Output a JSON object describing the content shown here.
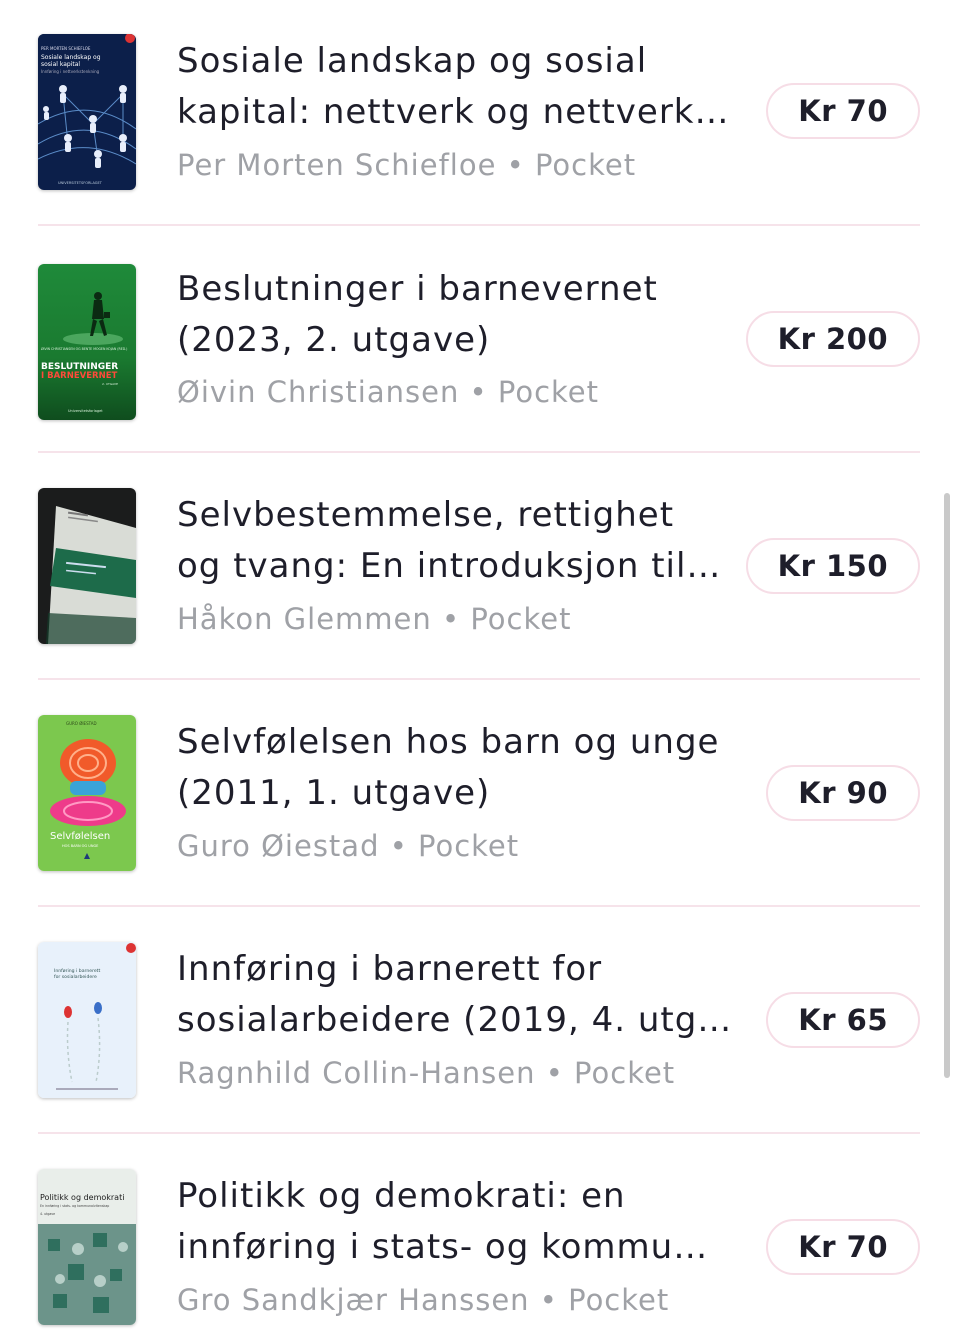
{
  "books": [
    {
      "title": "Sosiale landskap og sosial\nkapital: nettverk og nettverk…",
      "author": "Per Morten Schiefloe",
      "format": "Pocket",
      "price": "Kr 70",
      "cover_text": [
        "PER MORTEN SCHIEFLOE",
        "Sosiale landskap og",
        "sosial kapital",
        "Innføring i nettverkstenkning",
        "UNIVERSITETSFORLAGET"
      ]
    },
    {
      "title": "Beslutninger i barnevernet\n(2023, 2. utgave)",
      "author": "Øivin Christiansen",
      "format": "Pocket",
      "price": "Kr 200",
      "cover_text": [
        "ØIVIN CHRISTIANSEN OG BENTE MOGEN KOJAN (RED.)",
        "BESLUTNINGER",
        "I BARNEVERNET",
        "2. UTGAVE",
        "Universitetsforlaget"
      ]
    },
    {
      "title": "Selvbestemmelse, rettighet\nog tvang: En introduksjon til…",
      "author": "Håkon Glemmen",
      "format": "Pocket",
      "price": "Kr 150",
      "cover_text": []
    },
    {
      "title": "Selvfølelsen hos barn og unge\n(2011, 1. utgave)",
      "author": "Guro Øiestad",
      "format": "Pocket",
      "price": "Kr 90",
      "cover_text": [
        "GURO ØIESTAD",
        "Selvfølelsen",
        "HOS BARN OG UNGE"
      ]
    },
    {
      "title": "Innføring i barnerett for\nsosialarbeidere (2019, 4. utg…",
      "author": "Ragnhild Collin-Hansen",
      "format": "Pocket",
      "price": "Kr 65",
      "cover_text": [
        "Innføring i barnerett",
        "for sosialarbeidere"
      ]
    },
    {
      "title": "Politikk og demokrati: en\ninnføring i stats- og kommu…",
      "author": "Gro Sandkjær Hanssen",
      "format": "Pocket",
      "price": "Kr 70",
      "cover_text": [
        "Politikk og demokrati",
        "En innføring i stats- og kommunalvitenskap",
        "4. utgave"
      ]
    }
  ],
  "separator": "•",
  "colors": {
    "accent_border": "#f6dde6",
    "divider": "#f6e3ea",
    "title": "#1e1e2a",
    "meta": "#9fa1a6"
  }
}
